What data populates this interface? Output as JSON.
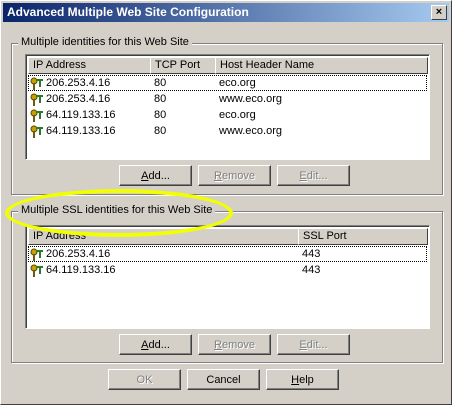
{
  "window": {
    "title": "Advanced Multiple Web Site Configuration",
    "close_label": "×"
  },
  "identities": {
    "group_label": "Multiple identities for this Web Site",
    "columns": [
      "IP Address",
      "TCP Port",
      "Host Header Name"
    ],
    "rows": [
      [
        "206.253.4.16",
        "80",
        "eco.org"
      ],
      [
        "206.253.4.16",
        "80",
        "www.eco.org"
      ],
      [
        "64.119.133.16",
        "80",
        "eco.org"
      ],
      [
        "64.119.133.16",
        "80",
        "www.eco.org"
      ]
    ],
    "buttons": {
      "add": "Add...",
      "remove": "Remove",
      "edit": "Edit..."
    }
  },
  "ssl_identities": {
    "group_label": "Multiple SSL identities for this Web Site",
    "columns": [
      "IP Address",
      "SSL Port"
    ],
    "rows": [
      [
        "206.253.4.16",
        "443"
      ],
      [
        "64.119.133.16",
        "443"
      ]
    ],
    "buttons": {
      "add": "Add...",
      "remove": "Remove",
      "edit": "Edit..."
    }
  },
  "footer": {
    "ok": "OK",
    "cancel": "Cancel",
    "help": "Help"
  },
  "colors": {
    "highlight": "#f2ff00",
    "titlebar_start": "#0a246a",
    "titlebar_end": "#a6caf0"
  },
  "icons": {
    "row_icon": "network-address-icon"
  }
}
